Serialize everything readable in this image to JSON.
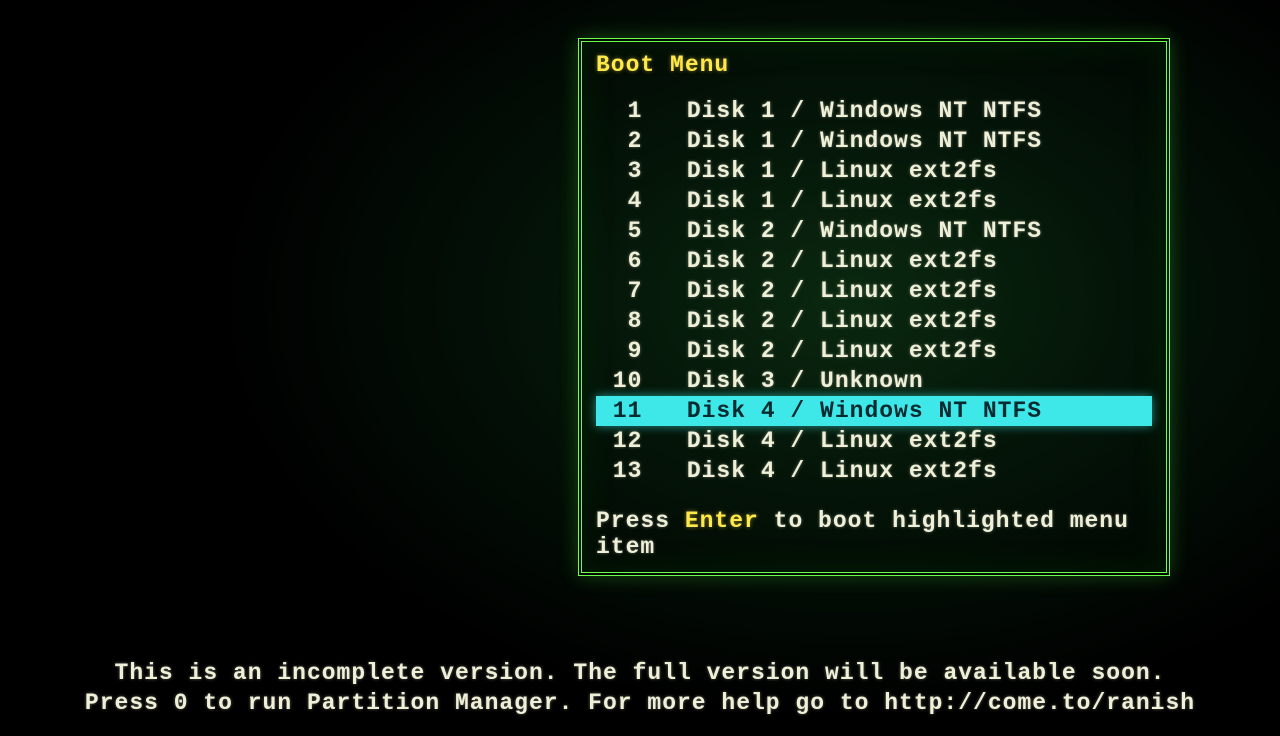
{
  "boot": {
    "title": "Boot Menu",
    "selected_index": 10,
    "items": [
      {
        "num": "1",
        "label": "Disk 1 / Windows NT NTFS"
      },
      {
        "num": "2",
        "label": "Disk 1 / Windows NT NTFS"
      },
      {
        "num": "3",
        "label": "Disk 1 / Linux ext2fs"
      },
      {
        "num": "4",
        "label": "Disk 1 / Linux ext2fs"
      },
      {
        "num": "5",
        "label": "Disk 2 / Windows NT NTFS"
      },
      {
        "num": "6",
        "label": "Disk 2 / Linux ext2fs"
      },
      {
        "num": "7",
        "label": "Disk 2 / Linux ext2fs"
      },
      {
        "num": "8",
        "label": "Disk 2 / Linux ext2fs"
      },
      {
        "num": "9",
        "label": "Disk 2 / Linux ext2fs"
      },
      {
        "num": "10",
        "label": "Disk 3 / Unknown"
      },
      {
        "num": "11",
        "label": "Disk 4 / Windows NT NTFS"
      },
      {
        "num": "12",
        "label": "Disk 4 / Linux ext2fs"
      },
      {
        "num": "13",
        "label": "Disk 4 / Linux ext2fs"
      }
    ],
    "hint_pre": "Press ",
    "hint_key": "Enter",
    "hint_post": " to boot highlighted menu item"
  },
  "footer": {
    "line1": "This is an incomplete version. The full version will be available soon.",
    "line2": "Press 0 to run Partition Manager. For more help go to http://come.to/ranish"
  }
}
